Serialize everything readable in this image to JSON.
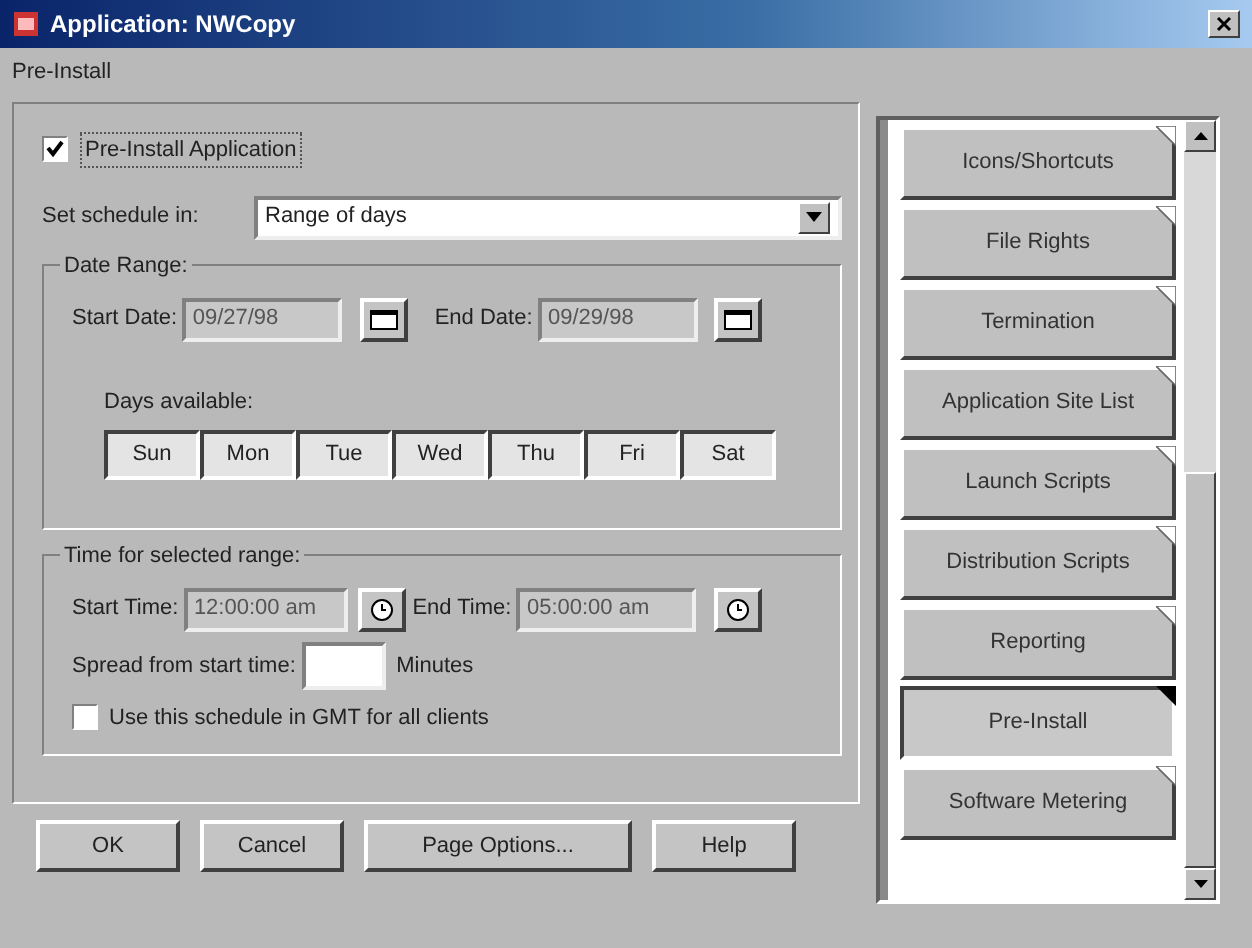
{
  "window": {
    "title": "Application: NWCopy"
  },
  "page_title": "Pre-Install",
  "preinstall_checkbox": {
    "label": "Pre-Install Application",
    "checked": true
  },
  "schedule": {
    "label": "Set schedule in:",
    "value": "Range of days"
  },
  "date_range": {
    "legend": "Date Range:",
    "start_label": "Start Date:",
    "start_value": "09/27/98",
    "end_label": "End Date:",
    "end_value": "09/29/98",
    "days_label": "Days available:",
    "days": [
      {
        "label": "Sun"
      },
      {
        "label": "Mon"
      },
      {
        "label": "Tue"
      },
      {
        "label": "Wed"
      },
      {
        "label": "Thu"
      },
      {
        "label": "Fri"
      },
      {
        "label": "Sat"
      }
    ]
  },
  "time_range": {
    "legend": "Time for selected range:",
    "start_label": "Start Time:",
    "start_value": "12:00:00 am",
    "end_label": "End Time:",
    "end_value": "05:00:00 am",
    "spread_label": "Spread from start time:",
    "spread_unit": "Minutes"
  },
  "gmt_checkbox": {
    "label": "Use this schedule in GMT for all clients",
    "checked": false
  },
  "buttons": [
    "OK",
    "Cancel",
    "Page Options...",
    "Help"
  ],
  "tabs": [
    {
      "label": "Icons/Shortcuts",
      "selected": false
    },
    {
      "label": "File Rights",
      "selected": false
    },
    {
      "label": "Termination",
      "selected": false
    },
    {
      "label": "Application Site List",
      "selected": false
    },
    {
      "label": "Launch Scripts",
      "selected": false
    },
    {
      "label": "Distribution Scripts",
      "selected": false
    },
    {
      "label": "Reporting",
      "selected": false
    },
    {
      "label": "Pre-Install",
      "selected": true
    },
    {
      "label": "Software Metering",
      "selected": false
    }
  ]
}
